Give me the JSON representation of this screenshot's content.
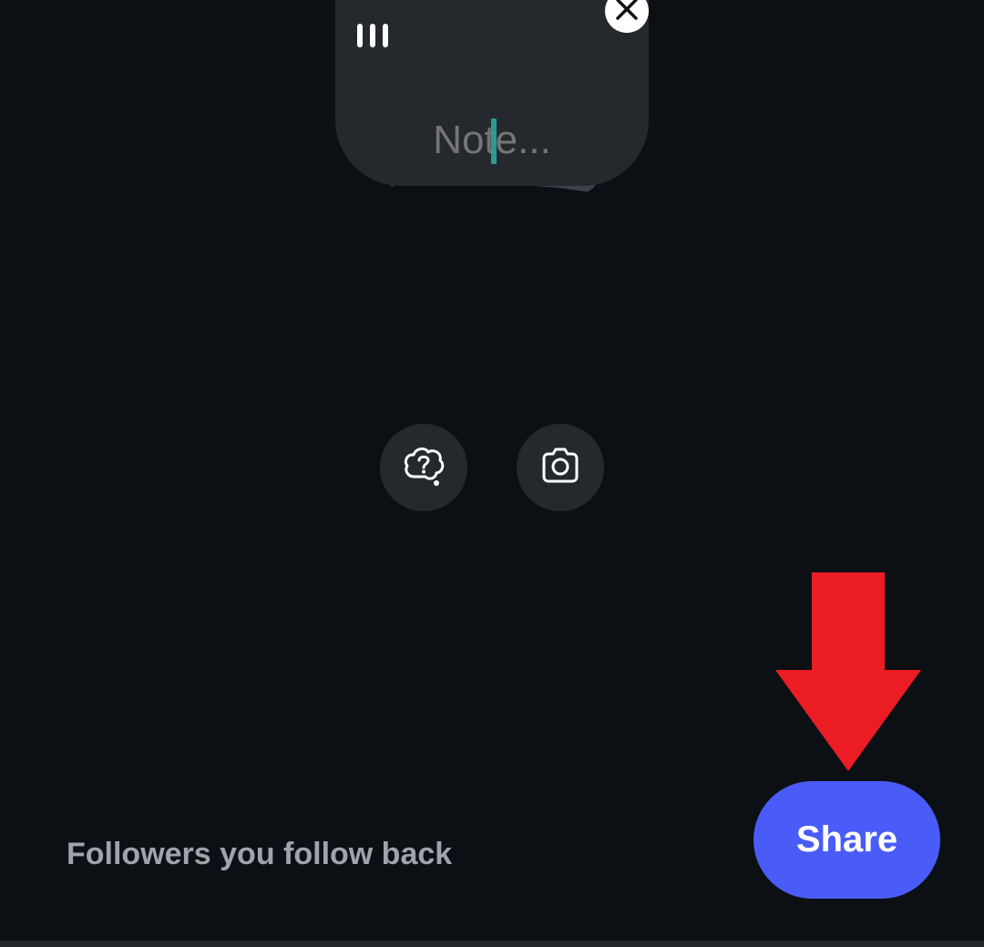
{
  "note": {
    "placeholder": "Note..."
  },
  "actions": {
    "prompt_icon": "question-bubble-icon",
    "camera_icon": "camera-icon",
    "close_icon": "close-icon",
    "voice_icon": "voice-bars-icon"
  },
  "audience": {
    "label": "Followers you follow back"
  },
  "share": {
    "label": "Share"
  },
  "colors": {
    "background": "#0c1014",
    "bubble": "#25292e",
    "share_button": "#4a5cf7",
    "caret": "#2aa89a",
    "annotation_arrow": "#ec1c24"
  }
}
